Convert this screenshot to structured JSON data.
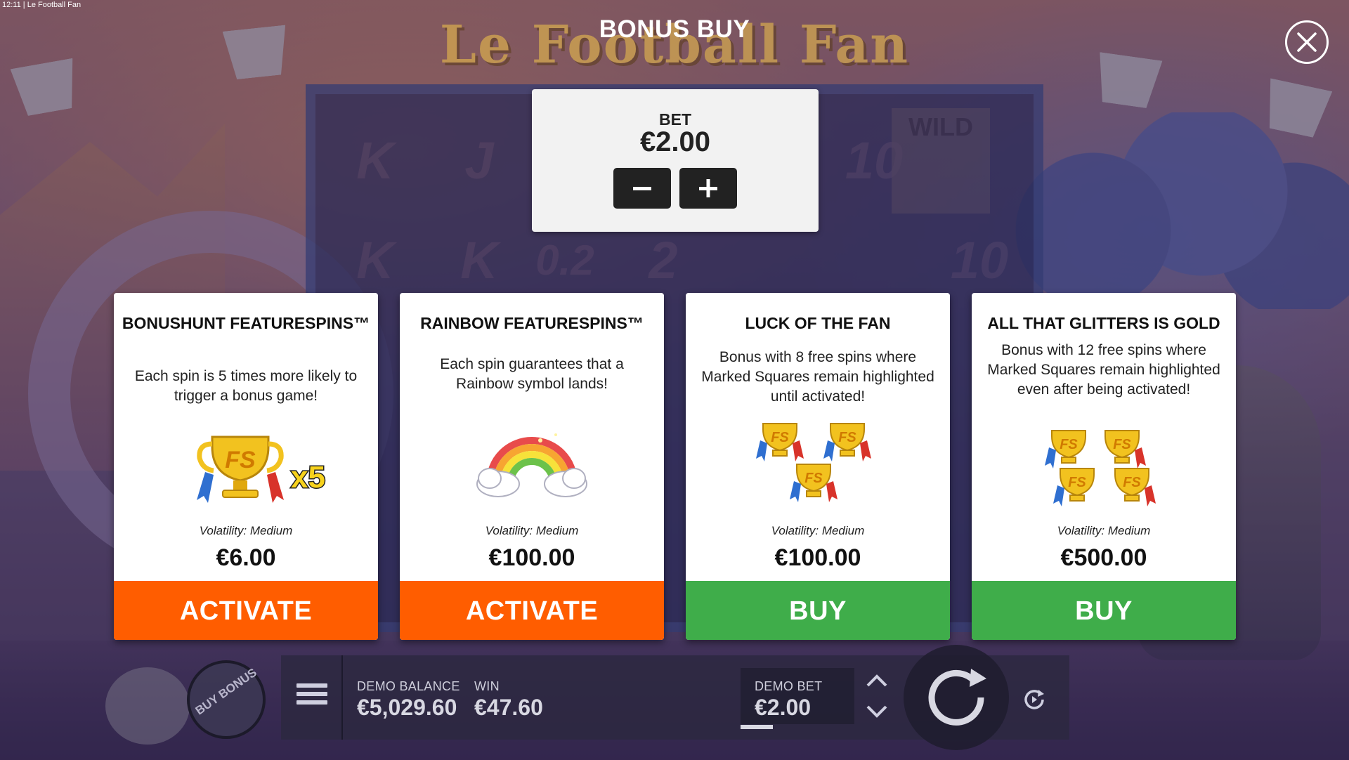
{
  "status_bar": {
    "time": "12:11",
    "separator": "|",
    "window_title": "Le Football Fan"
  },
  "game_logo": "Le Football Fan",
  "reel_symbols": [
    "K",
    "J",
    "10",
    "K",
    "K",
    "0.2",
    "2",
    "10"
  ],
  "wild_label": "WILD",
  "bonus_buy": {
    "title": "BONUS BUY",
    "bet_label": "BET",
    "bet_value": "€2.00",
    "decrease_icon": "minus-icon",
    "increase_icon": "plus-icon"
  },
  "cards": [
    {
      "title": "BONUSHUNT FEATURESPINS™",
      "description": "Each spin is 5 times more likely to trigger a bonus game!",
      "image": "fs-trophy-x5",
      "image_text": "FS",
      "multiplier_text": "x5",
      "volatility": "Volatility: Medium",
      "price": "€6.00",
      "button": "ACTIVATE",
      "button_color": "#ff5d00"
    },
    {
      "title": "RAINBOW FEATURESPINS™",
      "description": "Each spin guarantees that a Rainbow symbol lands!",
      "image": "rainbow",
      "volatility": "Volatility: Medium",
      "price": "€100.00",
      "button": "ACTIVATE",
      "button_color": "#ff5d00"
    },
    {
      "title": "LUCK OF THE FAN",
      "description": "Bonus with 8 free spins where Marked Squares remain highlighted until activated!",
      "image": "three-fs-trophies",
      "image_text": "FS",
      "volatility": "Volatility: Medium",
      "price": "€100.00",
      "button": "BUY",
      "button_color": "#3fad4a"
    },
    {
      "title": "ALL THAT GLITTERS IS GOLD",
      "description": "Bonus with 12 free spins where Marked Squares remain highlighted even after being activated!",
      "image": "four-fs-trophies",
      "image_text": "FS",
      "volatility": "Volatility: Medium",
      "price": "€500.00",
      "button": "BUY",
      "button_color": "#3fad4a"
    }
  ],
  "bottom_bar": {
    "buy_bonus_label": "BUY BONUS",
    "demo_balance_label": "DEMO BALANCE",
    "demo_balance_value": "€5,029.60",
    "win_label": "WIN",
    "win_value": "€47.60",
    "demo_bet_label": "DEMO BET",
    "demo_bet_value": "€2.00"
  },
  "colors": {
    "activate": "#ff5d00",
    "buy": "#3fad4a",
    "gold": "#f2c54a"
  }
}
